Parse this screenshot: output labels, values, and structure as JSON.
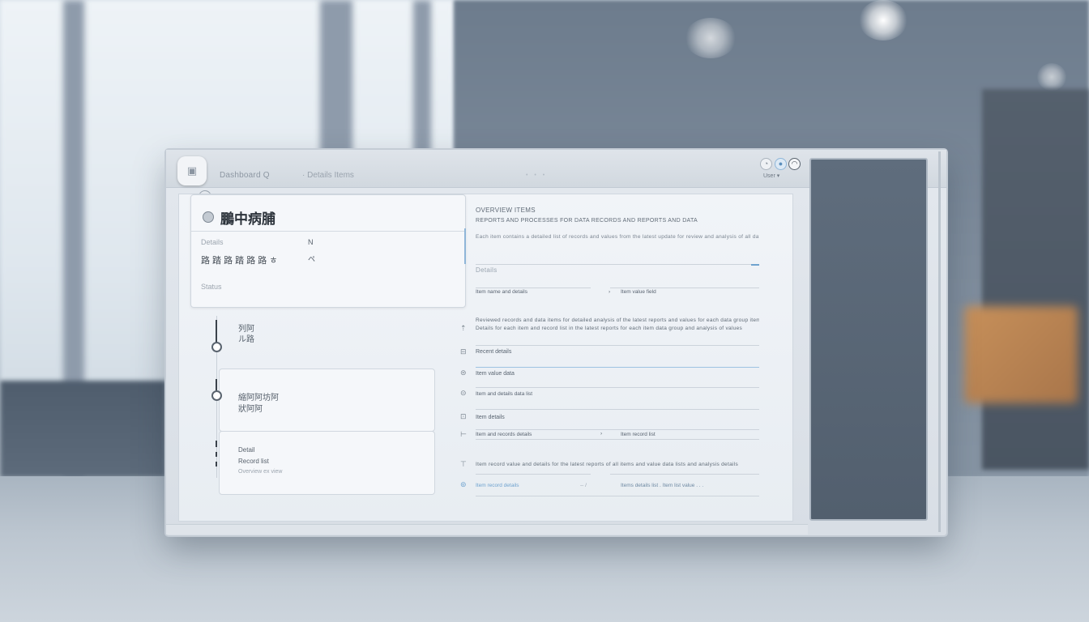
{
  "colors": {
    "accent": "#6fa3cf",
    "panel_dark": "#5a6878",
    "text_dark": "#2c333b"
  },
  "topbar": {
    "logo_icon": "app-logo-icon",
    "title": "Dashboard Q",
    "subtitle": "· Details Items",
    "dots": "• • •",
    "icons": [
      "bell-icon",
      "globe-icon",
      "user-icon"
    ],
    "user_label": "User ▾"
  },
  "card_main": {
    "title": "鵬中病脯",
    "label_1": "Details",
    "value_1": "N",
    "row_text": "路 踏 路 踏 路 路 ㅎ",
    "value_2": "ペ",
    "footer": "Status"
  },
  "timeline": {
    "node1_line1": "列阿",
    "node1_line2": "ル路",
    "node2_line1": "縮阿阿坊阿",
    "node2_line2": "狀阿阿",
    "node3_line1": "Detail",
    "node3_line2": "Record list",
    "node3_line3": "Overview ex view"
  },
  "right_panel": {
    "header": "OVERVIEW ITEMS",
    "header_long": "REPORTS AND PROCESSES FOR DATA RECORDS AND REPORTS AND DATA",
    "desc": "Each item contains a detailed list of records and values from the latest update for review and analysis of all data",
    "section_label": "Details",
    "label_a": "Item name and details",
    "label_b": "Item value field",
    "desc2": "Reviewed records and data items for detailed analysis of the latest reports and values for each data group item",
    "desc2_line2": "Details for each item and record list in the latest reports for each item data group and analysis of values",
    "label_c": "Recent details",
    "label_d": "Item value data",
    "label_e": "Item and details data list",
    "label_f": "Item details",
    "label_g": "Item and records details",
    "label_h": "Item record list",
    "desc3": "Item record value and details for the latest reports of all items and value data lists and analysis details",
    "footer_link": "Item record details",
    "footer_mid": "-- /",
    "footer_right": "Items details list . Item list value . . ."
  }
}
